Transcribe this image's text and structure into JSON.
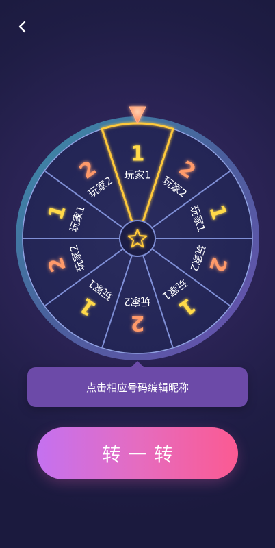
{
  "nav": {
    "back_icon": "chevron-left-icon"
  },
  "wheel": {
    "center_icon": "star-icon",
    "pointer_icon": "triangle-pointer-icon",
    "selected_index": 0,
    "segments": [
      {
        "number": "1",
        "label": "玩家1"
      },
      {
        "number": "2",
        "label": "玩家2"
      },
      {
        "number": "1",
        "label": "玩家1"
      },
      {
        "number": "2",
        "label": "玩家2"
      },
      {
        "number": "1",
        "label": "玩家1"
      },
      {
        "number": "2",
        "label": "玩家2"
      },
      {
        "number": "1",
        "label": "玩家1"
      },
      {
        "number": "2",
        "label": "玩家2"
      },
      {
        "number": "1",
        "label": "玩家1"
      },
      {
        "number": "2",
        "label": "玩家2"
      }
    ]
  },
  "hint": {
    "text": "点击相应号码编辑昵称"
  },
  "action": {
    "spin_label": "转一转"
  },
  "colors": {
    "number_one": "#ffd94a",
    "number_two": "#ff9a6a",
    "highlight": "#ffc93a",
    "divider": "#7f8fd6",
    "button_start": "#c471f0",
    "button_end": "#fb5a92"
  }
}
